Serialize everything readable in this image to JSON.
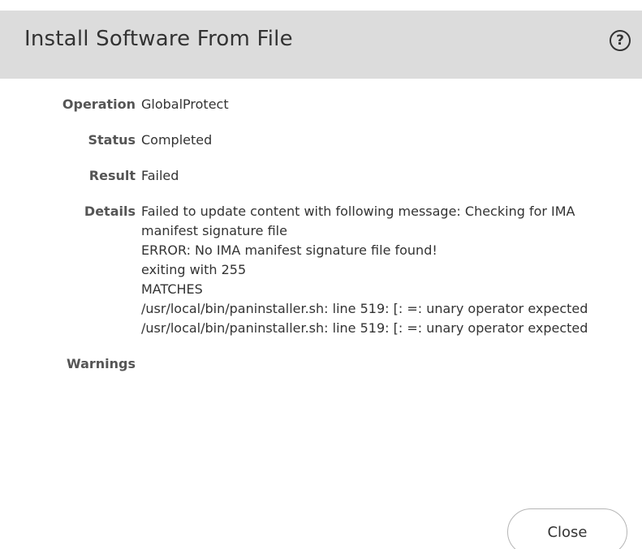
{
  "dialog": {
    "title": "Install Software From File",
    "help_icon_glyph": "?"
  },
  "fields": {
    "operation": {
      "label": "Operation",
      "value": "GlobalProtect"
    },
    "status": {
      "label": "Status",
      "value": "Completed"
    },
    "result": {
      "label": "Result",
      "value": "Failed"
    },
    "details": {
      "label": "Details",
      "lines": [
        "Failed to update content with following message: Checking for IMA manifest signature file",
        "ERROR: No IMA manifest signature file found!",
        "exiting with 255",
        "MATCHES",
        "/usr/local/bin/paninstaller.sh: line 519: [: =: unary operator expected",
        "/usr/local/bin/paninstaller.sh: line 519: [: =: unary operator expected"
      ]
    },
    "warnings": {
      "label": "Warnings",
      "value": ""
    }
  },
  "buttons": {
    "close_label": "Close"
  }
}
